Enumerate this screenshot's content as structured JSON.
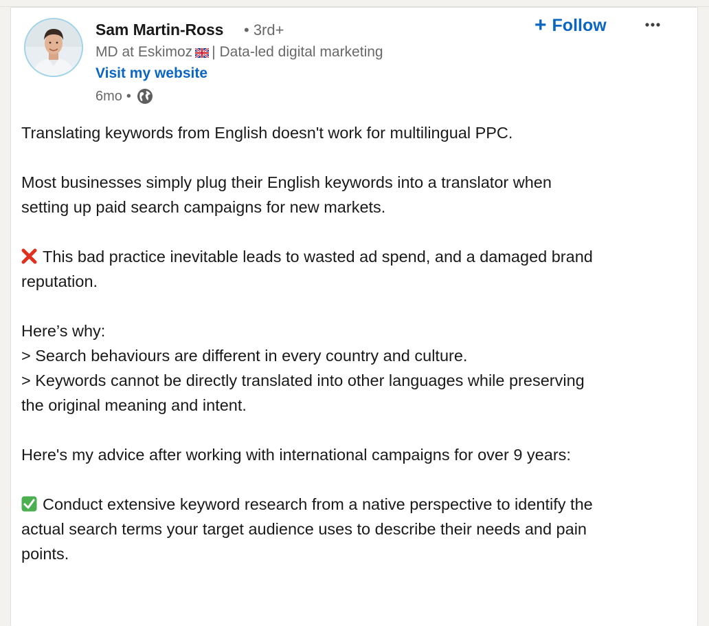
{
  "author": {
    "name": "Sam Martin-Ross",
    "degree": "• 3rd+",
    "headline_prefix": "MD at Eskimoz",
    "headline_suffix": "| Data-led digital marketing",
    "website_label": "Visit my website",
    "time": "6mo",
    "time_separator": "•"
  },
  "actions": {
    "follow_label": "Follow",
    "follow_icon": "plus-icon",
    "more_icon": "more-horizontal-icon"
  },
  "post": {
    "p1": "Translating keywords from English doesn't work for multilingual PPC.",
    "p2_line1": "Most businesses simply plug their English keywords into a translator when",
    "p2_line2": "setting up paid search campaigns for new markets.",
    "p3_line1": "This bad practice inevitable leads to wasted ad spend, and a damaged brand",
    "p3_line2": "reputation.",
    "p4_line1": "Here’s why:",
    "p4_line2": "> Search behaviours are different in every country and culture.",
    "p4_line3": "> Keywords cannot be directly translated into other languages while preserving",
    "p4_line4": "the original meaning and intent.",
    "p5": "Here's my advice after working with international campaigns for over 9 years:",
    "p6_line1": "Conduct extensive keyword research from a native perspective to identify the",
    "p6_line2": "actual search terms your target audience uses to describe their needs and pain",
    "p6_line3": "points."
  },
  "colors": {
    "link_blue": "#0a66c2",
    "avatar_ring": "#9fd3e8",
    "x_red": "#e0301e",
    "check_green": "#4caf50"
  }
}
